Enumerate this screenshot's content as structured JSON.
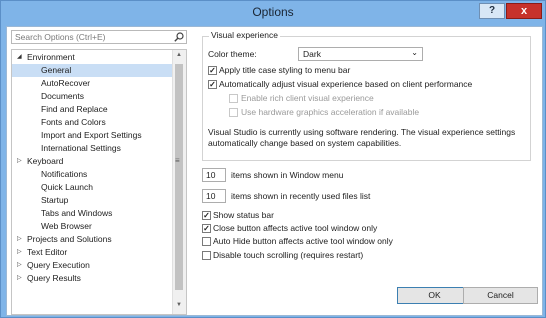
{
  "window": {
    "title": "Options",
    "help_label": "?",
    "close_label": "x"
  },
  "search": {
    "placeholder": "Search Options (Ctrl+E)"
  },
  "tree": {
    "items": [
      {
        "label": "Environment",
        "arrow": "◢"
      },
      {
        "label": "General"
      },
      {
        "label": "AutoRecover"
      },
      {
        "label": "Documents"
      },
      {
        "label": "Find and Replace"
      },
      {
        "label": "Fonts and Colors"
      },
      {
        "label": "Import and Export Settings"
      },
      {
        "label": "International Settings"
      },
      {
        "label": "Keyboard",
        "arrow": "▷"
      },
      {
        "label": "Notifications"
      },
      {
        "label": "Quick Launch"
      },
      {
        "label": "Startup"
      },
      {
        "label": "Tabs and Windows"
      },
      {
        "label": "Web Browser"
      },
      {
        "label": "Projects and Solutions",
        "arrow": "▷"
      },
      {
        "label": "Text Editor",
        "arrow": "▷"
      },
      {
        "label": "Query Execution",
        "arrow": "▷"
      },
      {
        "label": "Query Results",
        "arrow": "▷"
      }
    ],
    "selected_index": 1
  },
  "visual_experience": {
    "legend": "Visual experience",
    "color_theme_label": "Color theme:",
    "color_theme_value": "Dark",
    "apply_title_case": {
      "label": "Apply title case styling to menu bar",
      "checked": true
    },
    "auto_adjust": {
      "label": "Automatically adjust visual experience based on client performance",
      "checked": true
    },
    "rich_client": {
      "label": "Enable rich client visual experience",
      "checked": false
    },
    "hw_accel": {
      "label": "Use hardware graphics acceleration if available",
      "checked": false
    },
    "note": "Visual Studio is currently using software rendering.  The visual experience settings automatically change based on system capabilities."
  },
  "window_menu": {
    "value": "10",
    "label": "items shown in Window menu"
  },
  "recent_files": {
    "value": "10",
    "label": "items shown in recently used files list"
  },
  "options": [
    {
      "label": "Show status bar",
      "checked": true
    },
    {
      "label": "Close button affects active tool window only",
      "checked": true
    },
    {
      "label": "Auto Hide button affects active tool window only",
      "checked": false
    },
    {
      "label": "Disable touch scrolling (requires restart)",
      "checked": false
    }
  ],
  "buttons": {
    "ok": "OK",
    "cancel": "Cancel"
  },
  "colors": {
    "title_bar": "#7fb4e8",
    "close": "#c7322b",
    "selection": "#c9def5"
  }
}
